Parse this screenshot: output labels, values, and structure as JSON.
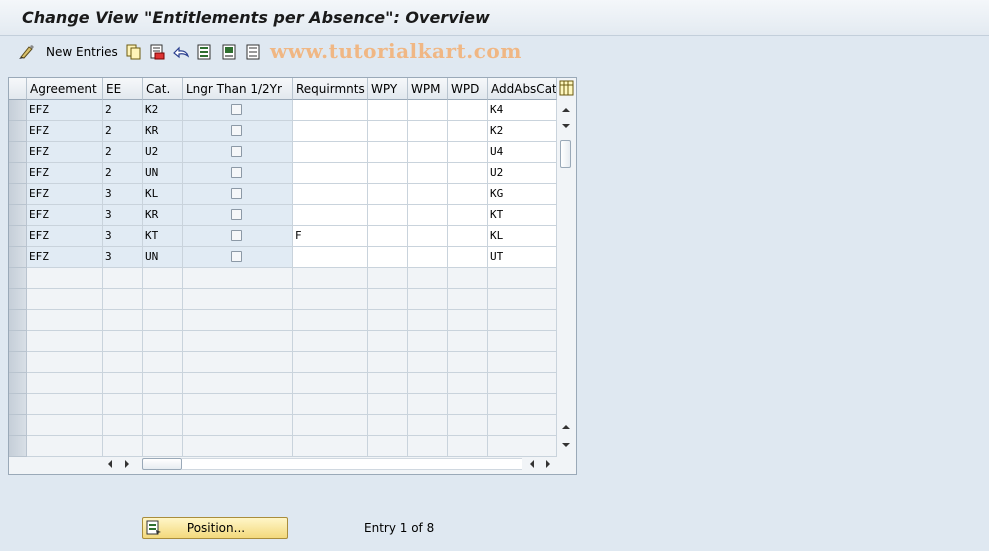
{
  "window": {
    "title": "Change View \"Entitlements per Absence\": Overview"
  },
  "toolbar": {
    "new_entries_label": "New Entries",
    "watermark": "www.tutorialkart.com",
    "icons": [
      "display-change-icon",
      "copy-icon",
      "delete-icon",
      "undo-icon",
      "select-all-icon",
      "select-block-icon",
      "deselect-all-icon"
    ]
  },
  "table": {
    "columns": [
      "Agreement",
      "EE",
      "Cat.",
      "Lngr Than 1/2Yr",
      "Requirmnts",
      "WPY",
      "WPM",
      "WPD",
      "AddAbsCat"
    ],
    "rows": [
      {
        "agreement": "EFZ",
        "ee": "2",
        "cat": "K2",
        "longer": false,
        "req": "",
        "wpy": "",
        "wpm": "",
        "wpd": "",
        "addabs": "K4"
      },
      {
        "agreement": "EFZ",
        "ee": "2",
        "cat": "KR",
        "longer": false,
        "req": "",
        "wpy": "",
        "wpm": "",
        "wpd": "",
        "addabs": "K2"
      },
      {
        "agreement": "EFZ",
        "ee": "2",
        "cat": "U2",
        "longer": false,
        "req": "",
        "wpy": "",
        "wpm": "",
        "wpd": "",
        "addabs": "U4"
      },
      {
        "agreement": "EFZ",
        "ee": "2",
        "cat": "UN",
        "longer": false,
        "req": "",
        "wpy": "",
        "wpm": "",
        "wpd": "",
        "addabs": "U2"
      },
      {
        "agreement": "EFZ",
        "ee": "3",
        "cat": "KL",
        "longer": false,
        "req": "",
        "wpy": "",
        "wpm": "",
        "wpd": "",
        "addabs": "KG"
      },
      {
        "agreement": "EFZ",
        "ee": "3",
        "cat": "KR",
        "longer": false,
        "req": "",
        "wpy": "",
        "wpm": "",
        "wpd": "",
        "addabs": "KT"
      },
      {
        "agreement": "EFZ",
        "ee": "3",
        "cat": "KT",
        "longer": false,
        "req": "F",
        "wpy": "",
        "wpm": "",
        "wpd": "",
        "addabs": "KL"
      },
      {
        "agreement": "EFZ",
        "ee": "3",
        "cat": "UN",
        "longer": false,
        "req": "",
        "wpy": "",
        "wpm": "",
        "wpd": "",
        "addabs": "UT"
      }
    ],
    "empty_rows": 9
  },
  "footer": {
    "position_label": "Position...",
    "entry_info": "Entry 1 of 8"
  },
  "colors": {
    "background": "#dfe8f1",
    "readonly_cell": "#e1ebf4",
    "editable_cell": "#ffffff",
    "position_button": "#f3d97c"
  }
}
